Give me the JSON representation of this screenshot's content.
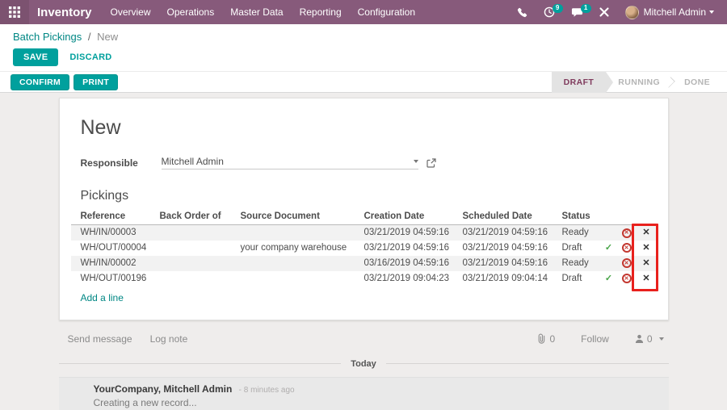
{
  "topbar": {
    "app_name": "Inventory",
    "menus": [
      "Overview",
      "Operations",
      "Master Data",
      "Reporting",
      "Configuration"
    ],
    "activity_badge": "9",
    "message_badge": "1",
    "user_name": "Mitchell Admin"
  },
  "breadcrumb": {
    "parent": "Batch Pickings",
    "separator": "/",
    "current": "New"
  },
  "actions": {
    "save": "SAVE",
    "discard": "DISCARD",
    "confirm": "CONFIRM",
    "print": "PRINT"
  },
  "statusbar": {
    "steps": [
      {
        "label": "DRAFT",
        "active": true
      },
      {
        "label": "RUNNING",
        "active": false
      },
      {
        "label": "DONE",
        "active": false
      }
    ]
  },
  "form": {
    "title": "New",
    "responsible_label": "Responsible",
    "responsible_value": "Mitchell Admin",
    "section_title": "Pickings",
    "table": {
      "headers": [
        "Reference",
        "Back Order of",
        "Source Document",
        "Creation Date",
        "Scheduled Date",
        "Status"
      ],
      "rows": [
        {
          "reference": "WH/IN/00003",
          "back_order": "",
          "source": "",
          "creation": "03/21/2019 04:59:16",
          "scheduled": "03/21/2019 04:59:16",
          "status": "Ready",
          "check": ""
        },
        {
          "reference": "WH/OUT/00004",
          "back_order": "",
          "source": "your company warehouse",
          "creation": "03/21/2019 04:59:16",
          "scheduled": "03/21/2019 04:59:16",
          "status": "Draft",
          "check": "✓"
        },
        {
          "reference": "WH/IN/00002",
          "back_order": "",
          "source": "",
          "creation": "03/16/2019 04:59:16",
          "scheduled": "03/21/2019 04:59:16",
          "status": "Ready",
          "check": ""
        },
        {
          "reference": "WH/OUT/00196",
          "back_order": "",
          "source": "",
          "creation": "03/21/2019 09:04:23",
          "scheduled": "03/21/2019 09:04:14",
          "status": "Draft",
          "check": "✓"
        }
      ],
      "add_line": "Add a line"
    }
  },
  "icons": {
    "cancel_glyph": "✕",
    "delete_glyph": "✕"
  },
  "chatter": {
    "send_message": "Send message",
    "log_note": "Log note",
    "attachment_count": "0",
    "follow_label": "Follow",
    "follower_count": "0",
    "date_divider": "Today",
    "message": {
      "author": "YourCompany, Mitchell Admin",
      "time": "- 8 minutes ago",
      "body": "Creating a new record..."
    }
  },
  "colors": {
    "brand": "#875a7b",
    "accent": "#00a09d",
    "link": "#008784",
    "success": "#47a447",
    "danger": "#c3372f",
    "annotation": "#e8211d"
  }
}
